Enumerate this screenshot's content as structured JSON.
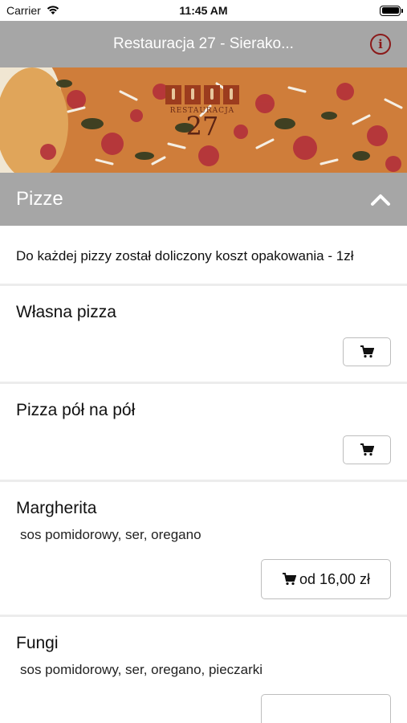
{
  "status": {
    "carrier": "Carrier",
    "time": "11:45 AM"
  },
  "nav": {
    "title": "Restauracja 27 - Sierako...",
    "info_icon": "info-icon"
  },
  "banner": {
    "logo_text": "RESTAURACJA",
    "logo_number": "27"
  },
  "section": {
    "title": "Pizze",
    "toggle_icon": "chevron-up-icon"
  },
  "note": "Do każdej pizzy został doliczony koszt opakowania - 1zł",
  "items": [
    {
      "name": "Własna pizza",
      "description": "",
      "price": ""
    },
    {
      "name": "Pizza pół na pół",
      "description": "",
      "price": ""
    },
    {
      "name": "Margherita",
      "description": "sos pomidorowy, ser, oregano",
      "price": "od 16,00 zł"
    },
    {
      "name": "Fungi",
      "description": "sos pomidorowy, ser, oregano, pieczarki",
      "price": ""
    }
  ],
  "colors": {
    "header_gray": "#a6a6a6",
    "info_red": "#8b1a1a",
    "divider": "#ececec"
  }
}
